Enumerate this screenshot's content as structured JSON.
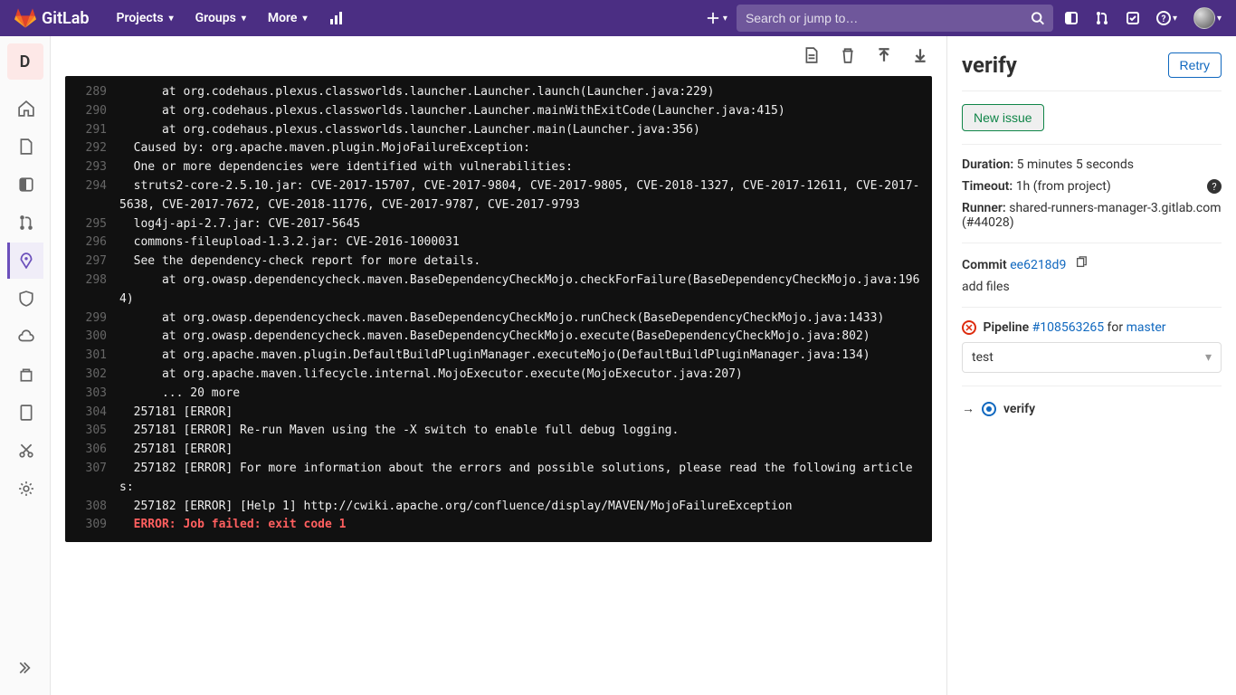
{
  "brand": "GitLab",
  "nav": {
    "projects": "Projects",
    "groups": "Groups",
    "more": "More"
  },
  "search": {
    "placeholder": "Search or jump to…"
  },
  "projectBadge": "D",
  "logToolbar": {
    "raw": "Show complete raw",
    "erase": "Erase job log",
    "top": "Scroll to top",
    "bottom": "Scroll to bottom"
  },
  "log": [
    {
      "n": 289,
      "t": "      at org.codehaus.plexus.classworlds.launcher.Launcher.launch(Launcher.java:229)"
    },
    {
      "n": 290,
      "t": "      at org.codehaus.plexus.classworlds.launcher.Launcher.mainWithExitCode(Launcher.java:415)"
    },
    {
      "n": 291,
      "t": "      at org.codehaus.plexus.classworlds.launcher.Launcher.main(Launcher.java:356)"
    },
    {
      "n": 292,
      "t": "  Caused by: org.apache.maven.plugin.MojoFailureException:"
    },
    {
      "n": 293,
      "t": "  One or more dependencies were identified with vulnerabilities:"
    },
    {
      "n": 294,
      "t": "  struts2-core-2.5.10.jar: CVE-2017-15707, CVE-2017-9804, CVE-2017-9805, CVE-2018-1327, CVE-2017-12611, CVE-2017-5638, CVE-2017-7672, CVE-2018-11776, CVE-2017-9787, CVE-2017-9793"
    },
    {
      "n": 295,
      "t": "  log4j-api-2.7.jar: CVE-2017-5645"
    },
    {
      "n": 296,
      "t": "  commons-fileupload-1.3.2.jar: CVE-2016-1000031"
    },
    {
      "n": 297,
      "t": "  See the dependency-check report for more details."
    },
    {
      "n": 298,
      "t": "      at org.owasp.dependencycheck.maven.BaseDependencyCheckMojo.checkForFailure(BaseDependencyCheckMojo.java:1964)"
    },
    {
      "n": 299,
      "t": "      at org.owasp.dependencycheck.maven.BaseDependencyCheckMojo.runCheck(BaseDependencyCheckMojo.java:1433)"
    },
    {
      "n": 300,
      "t": "      at org.owasp.dependencycheck.maven.BaseDependencyCheckMojo.execute(BaseDependencyCheckMojo.java:802)"
    },
    {
      "n": 301,
      "t": "      at org.apache.maven.plugin.DefaultBuildPluginManager.executeMojo(DefaultBuildPluginManager.java:134)"
    },
    {
      "n": 302,
      "t": "      at org.apache.maven.lifecycle.internal.MojoExecutor.execute(MojoExecutor.java:207)"
    },
    {
      "n": 303,
      "t": "      ... 20 more"
    },
    {
      "n": 304,
      "t": "  257181 [ERROR]"
    },
    {
      "n": 305,
      "t": "  257181 [ERROR] Re-run Maven using the -X switch to enable full debug logging."
    },
    {
      "n": 306,
      "t": "  257181 [ERROR]"
    },
    {
      "n": 307,
      "t": "  257182 [ERROR] For more information about the errors and possible solutions, please read the following articles:"
    },
    {
      "n": 308,
      "t": "  257182 [ERROR] [Help 1] http://cwiki.apache.org/confluence/display/MAVEN/MojoFailureException"
    },
    {
      "n": 309,
      "t": "  ERROR: Job failed: exit code 1",
      "err": true
    }
  ],
  "side": {
    "title": "verify",
    "retry": "Retry",
    "newIssue": "New issue",
    "durationLabel": "Duration:",
    "durationValue": "5 minutes 5 seconds",
    "timeoutLabel": "Timeout:",
    "timeoutValue": "1h (from project)",
    "runnerLabel": "Runner:",
    "runnerValue": "shared-runners-manager-3.gitlab.com (#44028)",
    "commitLabel": "Commit",
    "commitSha": "ee6218d9",
    "commitMsg": "add files",
    "pipelineLabel": "Pipeline",
    "pipelineId": "#108563265",
    "pipelineFor": "for",
    "pipelineRef": "master",
    "stage": "test",
    "jobName": "verify"
  }
}
